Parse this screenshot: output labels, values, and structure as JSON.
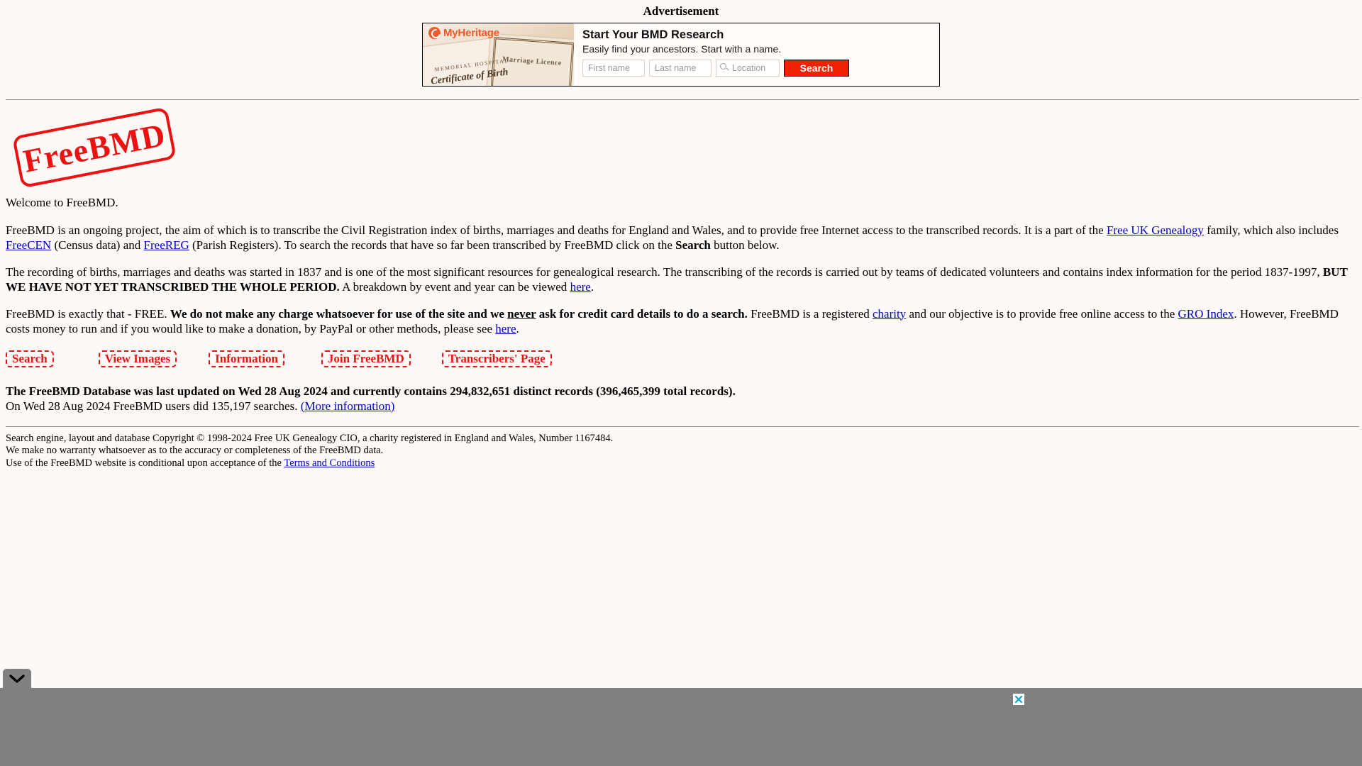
{
  "ad": {
    "label": "Advertisement",
    "brand": "MyHeritage",
    "headline": "Start Your BMD Research",
    "subhead": "Easily find your ancestors. Start with a name.",
    "image_text_hospital": "MEMORIAL HOSPITAL",
    "image_text_certificate": "Certificate of Birth",
    "image_text_marriage": "Marriage Licence",
    "first_name_placeholder": "First name",
    "last_name_placeholder": "Last name",
    "location_placeholder": "Location",
    "first_name_value": "",
    "last_name_value": "",
    "location_value": "",
    "search_label": "Search",
    "search_button_color": "#ee2200",
    "brand_color": "#f05a28"
  },
  "site": {
    "logo_text": "FreeBMD",
    "logo_color": "#ee1111"
  },
  "intro": {
    "welcome": "Welcome to FreeBMD.",
    "p2_a": "FreeBMD is an ongoing project, the aim of which is to transcribe the Civil Registration index of births, marriages and deaths for England and Wales, and to provide free Internet access to the transcribed records. It is a part of the ",
    "p2_link1": "Free UK Genealogy",
    "p2_b": " family, which also includes ",
    "p2_link2": "FreeCEN",
    "p2_c": " (Census data) and ",
    "p2_link3": "FreeREG",
    "p2_d": " (Parish Registers). To search the records that have so far been transcribed by FreeBMD click on the ",
    "p2_bold": "Search",
    "p2_e": " button below.",
    "p3_a": "The recording of births, marriages and deaths was started in 1837 and is one of the most significant resources for genealogical research. The transcribing of the records is carried out by teams of dedicated volunteers and contains index information for the period 1837-1997, ",
    "p3_bold": "BUT WE HAVE NOT YET TRANSCRIBED THE WHOLE PERIOD.",
    "p3_b": " A breakdown by event and year can be viewed ",
    "p3_link": "here",
    "p3_c": ".",
    "p4_a": "FreeBMD is exactly that - FREE. ",
    "p4_bold1": "We do not make any charge whatsoever for use of the site and we ",
    "p4_bold_underline": "never",
    "p4_bold2": " ask for credit card details to do a search.",
    "p4_b": " FreeBMD is a registered ",
    "p4_link1": "charity",
    "p4_c": " and our objective is to provide free online access to the ",
    "p4_link2": "GRO Index",
    "p4_d": ". However, FreeBMD costs money to run and if you would like to make a donation, by PayPal or other methods, please see ",
    "p4_link3": "here",
    "p4_e": "."
  },
  "nav": {
    "search": "Search",
    "view_images": "View Images",
    "information": "Information",
    "join": "Join FreeBMD",
    "transcribers": "Transcribers' Page"
  },
  "stats": {
    "line1": "The FreeBMD Database was last updated on Wed 28 Aug 2024 and currently contains 294,832,651 distinct records (396,465,399 total records).",
    "line2_a": "On Wed 28 Aug 2024 FreeBMD users did 135,197 searches. ",
    "line2_link": "(More information)",
    "last_updated": "Wed 28 Aug 2024",
    "distinct_records": "294,832,651",
    "total_records": "396,465,399",
    "searches": "135,197"
  },
  "footer": {
    "line1": "Search engine, layout and database Copyright © 1998-2024 Free UK Genealogy CIO, a charity registered in England and Wales, Number 1167484.",
    "line2": "We make no warranty whatsoever as to the accuracy or completeness of the FreeBMD data.",
    "line3_a": "Use of the FreeBMD website is conditional upon acceptance of the ",
    "line3_link": "Terms and Conditions"
  },
  "bottom_bar": {
    "collapse_icon": "chevron-down-icon",
    "close_icon": "close-icon",
    "bar_color": "#808080",
    "close_glyph": "✕"
  }
}
